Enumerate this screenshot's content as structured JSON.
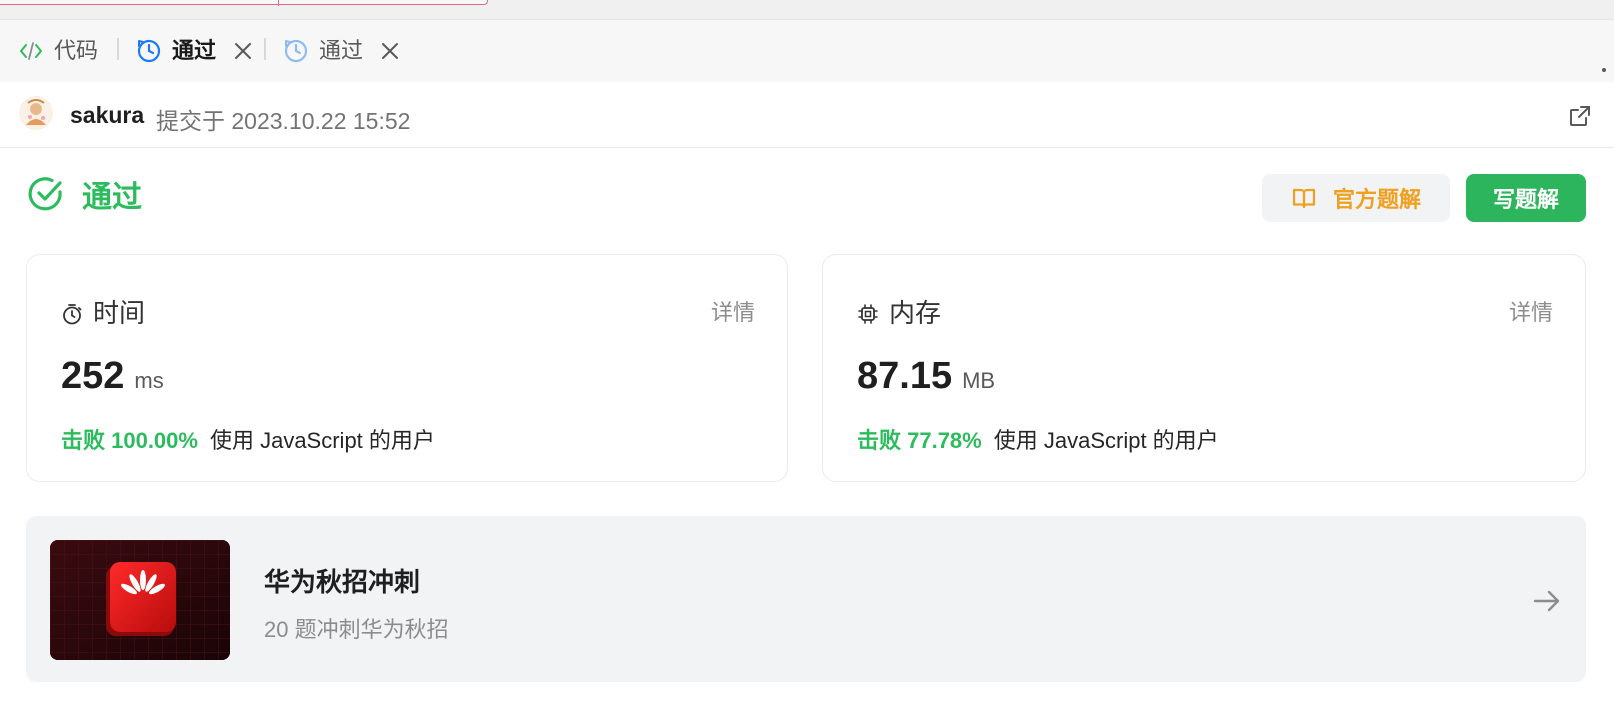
{
  "tabs": [
    {
      "label": "代码",
      "icon": "code-icon"
    },
    {
      "label": "通过",
      "icon": "clock-refresh-icon",
      "active": true
    },
    {
      "label": "通过",
      "icon": "clock-refresh-icon",
      "active": false
    }
  ],
  "submission": {
    "user": "sakura",
    "meta": "提交于 2023.10.22 15:52"
  },
  "status": {
    "text": "通过",
    "color": "#2cbb5d"
  },
  "buttons": {
    "official_solution": "官方题解",
    "write_solution": "写题解"
  },
  "time_card": {
    "title": "时间",
    "detail": "详情",
    "value": "252",
    "unit": "ms",
    "beat": "击败 100.00%",
    "beat_desc": "使用 JavaScript 的用户"
  },
  "memory_card": {
    "title": "内存",
    "detail": "详情",
    "value": "87.15",
    "unit": "MB",
    "beat": "击败 77.78%",
    "beat_desc": "使用 JavaScript 的用户"
  },
  "promo": {
    "title": "华为秋招冲刺",
    "subtitle": "20 题冲刺华为秋招",
    "logo_text": "HUAWEI"
  },
  "colors": {
    "accent_green": "#2cbb5d",
    "button_green": "#2db55d",
    "official_orange": "#f0a020",
    "tab_icon_blue": "#1a7af8"
  }
}
